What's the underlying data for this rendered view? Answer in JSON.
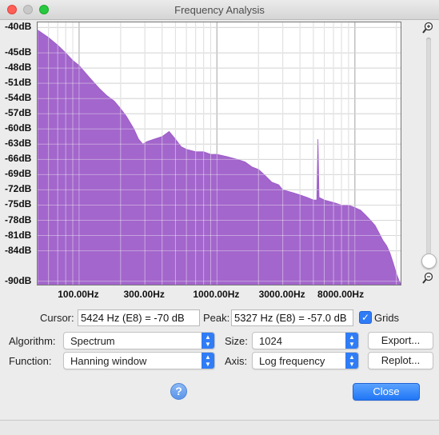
{
  "window": {
    "title": "Frequency Analysis"
  },
  "y_axis": {
    "labels": [
      "-40dB",
      "-45dB",
      "-48dB",
      "-51dB",
      "-54dB",
      "-57dB",
      "-60dB",
      "-63dB",
      "-66dB",
      "-69dB",
      "-72dB",
      "-75dB",
      "-78dB",
      "-81dB",
      "-84dB",
      "-90dB"
    ]
  },
  "x_axis": {
    "labels": [
      "100.00Hz",
      "300.00Hz",
      "1000.00Hz",
      "3000.00Hz",
      "8000.00Hz"
    ]
  },
  "chart_data": {
    "type": "area",
    "title": "",
    "xlabel": "",
    "ylabel": "",
    "x_scale": "log",
    "x_range_hz": [
      50,
      22050
    ],
    "y_range_db": [
      -91,
      -39
    ],
    "grid": true,
    "fill_color": "#9b59c8",
    "series": [
      {
        "x": [
          50,
          60,
          70,
          80,
          90,
          100,
          120,
          140,
          160,
          180,
          200,
          220,
          250,
          270,
          290,
          310,
          350,
          400,
          450,
          500,
          550,
          600,
          700,
          800,
          900,
          1000,
          1200,
          1400,
          1600,
          1800,
          2000,
          2200,
          2500,
          2800,
          3000,
          3500,
          4000,
          4500,
          5000,
          5300,
          5400,
          5500,
          6000,
          7000,
          8000,
          9000,
          10000,
          11000,
          12000,
          13000,
          14000,
          15000,
          16000,
          17000,
          18000,
          19000,
          20000,
          21000,
          22000
        ],
        "y": [
          -40.5,
          -42,
          -43.5,
          -45,
          -46.5,
          -47.5,
          -50,
          -52,
          -53.5,
          -54.5,
          -56,
          -57.5,
          -60,
          -62,
          -63,
          -62.5,
          -62,
          -61.5,
          -60.5,
          -62,
          -63.5,
          -64,
          -64.5,
          -64.5,
          -65,
          -65,
          -65.5,
          -66,
          -66.5,
          -67.5,
          -68,
          -69,
          -70.5,
          -71,
          -72,
          -72.5,
          -73,
          -73.5,
          -74,
          -74,
          -62,
          -73.5,
          -74,
          -74.5,
          -75,
          -75,
          -75.5,
          -76,
          -77,
          -78,
          -79,
          -80.5,
          -82,
          -83,
          -84.5,
          -86.5,
          -88.5,
          -90,
          -91
        ]
      }
    ]
  },
  "controls": {
    "cursor_label": "Cursor:",
    "cursor_value": "5424 Hz (E8) = -70 dB",
    "peak_label": "Peak:",
    "peak_value": "5327 Hz (E8) = -57.0 dB",
    "grids_label": "Grids",
    "grids_checked": true,
    "algorithm_label": "Algorithm:",
    "algorithm_value": "Spectrum",
    "size_label": "Size:",
    "size_value": "1024",
    "function_label": "Function:",
    "function_value": "Hanning window",
    "axis_label": "Axis:",
    "axis_value": "Log frequency",
    "export_label": "Export...",
    "replot_label": "Replot...",
    "close_label": "Close",
    "help_label": "?"
  },
  "icons": {
    "zoom_in": "zoom-in-icon",
    "zoom_out": "zoom-out-icon",
    "help": "help-icon"
  },
  "slider": {
    "zoom_level": 1.0
  }
}
